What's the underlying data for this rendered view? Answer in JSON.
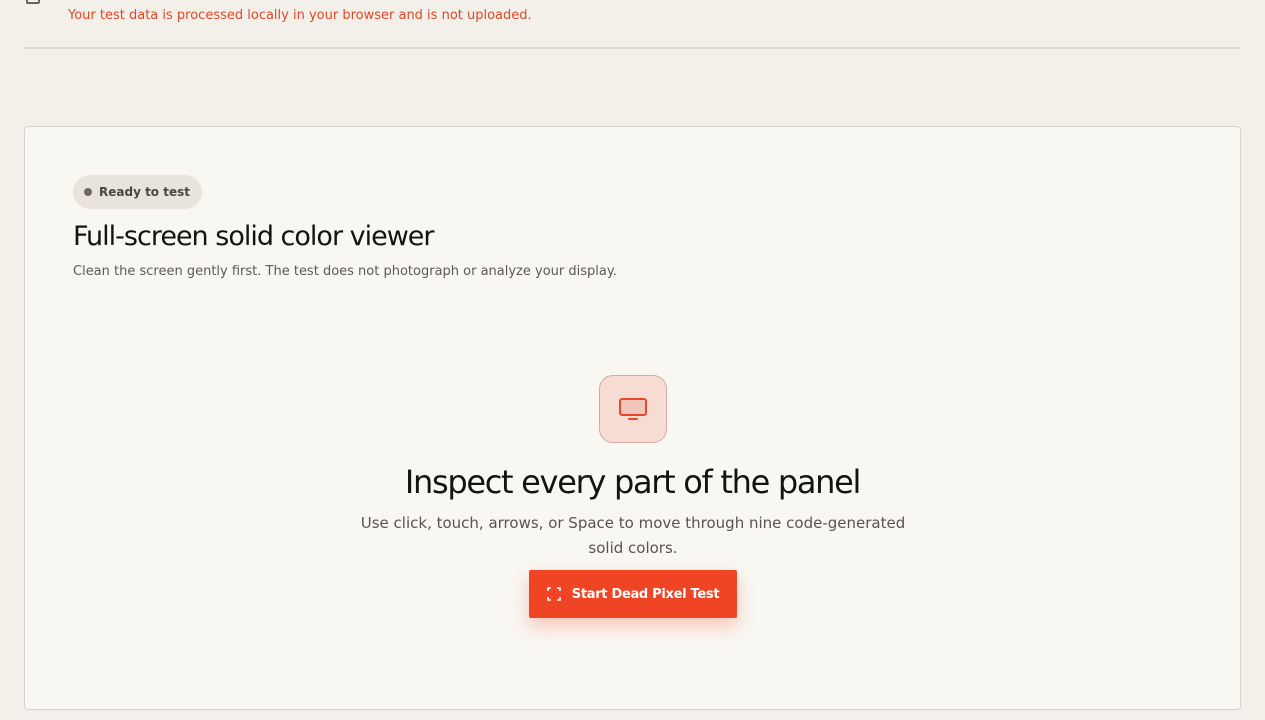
{
  "privacy": {
    "note": "Your test data is processed locally in your browser and is not uploaded."
  },
  "panel": {
    "status": "Ready to test",
    "title": "Full-screen solid color viewer",
    "subtitle": "Clean the screen gently first. The test does not photograph or analyze your display."
  },
  "hero": {
    "icon": "monitor-icon",
    "title": "Inspect every part of the panel",
    "description": "Use click, touch, arrows, or Space to move through nine code-generated solid colors.",
    "button_icon": "fullscreen-icon",
    "button_label": "Start Dead Pixel Test"
  },
  "colors": {
    "accent": "#ef4524",
    "note": "#e0472a",
    "background": "#f3f0e9",
    "panel": "#f9f7f2"
  }
}
